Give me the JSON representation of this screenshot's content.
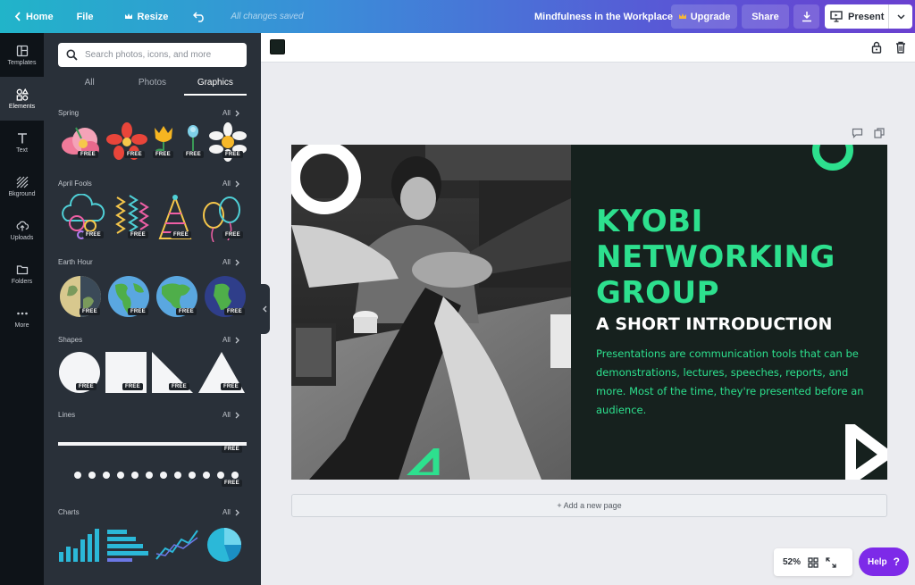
{
  "topbar": {
    "home": "Home",
    "file": "File",
    "resize": "Resize",
    "saved_status": "All changes saved",
    "doc_title": "Mindfulness in the Workplace",
    "upgrade": "Upgrade",
    "share": "Share",
    "present": "Present"
  },
  "rail": [
    {
      "label": "Templates",
      "icon": "templates-icon"
    },
    {
      "label": "Elements",
      "icon": "elements-icon"
    },
    {
      "label": "Text",
      "icon": "text-icon"
    },
    {
      "label": "Bkground",
      "icon": "background-icon"
    },
    {
      "label": "Uploads",
      "icon": "upload-icon"
    },
    {
      "label": "Folders",
      "icon": "folder-icon"
    },
    {
      "label": "More",
      "icon": "more-icon"
    }
  ],
  "panel": {
    "search_placeholder": "Search photos, icons, and more",
    "tabs": [
      "All",
      "Photos",
      "Graphics"
    ],
    "active_tab": "Graphics",
    "all_label": "All",
    "free_label": "FREE",
    "sections": [
      "Spring",
      "April Fools",
      "Earth Hour",
      "Shapes",
      "Lines",
      "Charts"
    ]
  },
  "slide": {
    "title": "KYOBI NETWORKING GROUP",
    "subtitle": "A SHORT INTRODUCTION",
    "body": "Presentations are communication tools that can be demonstrations, lectures, speeches, reports, and more. Most of the time, they're presented before an audience.",
    "accent_color": "#2de08e",
    "background_color": "#16211e"
  },
  "editor": {
    "add_page": "+ Add a new page",
    "zoom": "52%",
    "help": "Help",
    "help_icon": "?"
  }
}
